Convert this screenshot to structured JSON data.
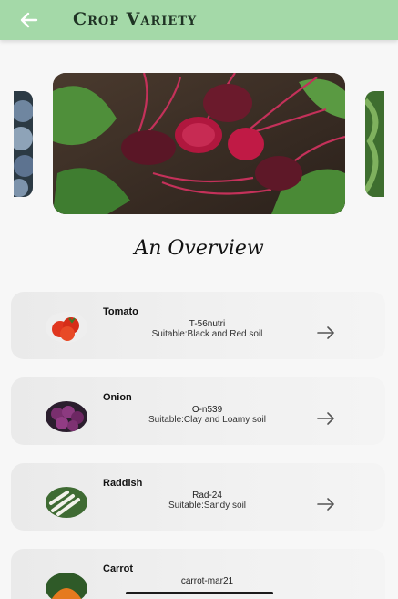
{
  "header": {
    "title": "Crop Variety",
    "back_icon": "arrow-left-icon",
    "color": "#a4d9a8"
  },
  "carousel": {
    "slides": [
      "plums-image",
      "beetroot-image",
      "leafy-greens-image"
    ],
    "active": 1
  },
  "section": {
    "title": "An Overview"
  },
  "crops": [
    {
      "name": "Tomato",
      "code": "T-56nutri",
      "suitability": "Suitable:Black and Red soil",
      "icon": "arrow-right-icon"
    },
    {
      "name": "Onion",
      "code": "O-n539",
      "suitability": "Suitable:Clay and Loamy soil",
      "icon": "arrow-right-icon"
    },
    {
      "name": "Raddish",
      "code": "Rad-24",
      "suitability": "Suitable:Sandy soil",
      "icon": "arrow-right-icon"
    },
    {
      "name": "Carrot",
      "code": "carrot-mar21",
      "suitability": "",
      "icon": "arrow-right-icon"
    }
  ]
}
